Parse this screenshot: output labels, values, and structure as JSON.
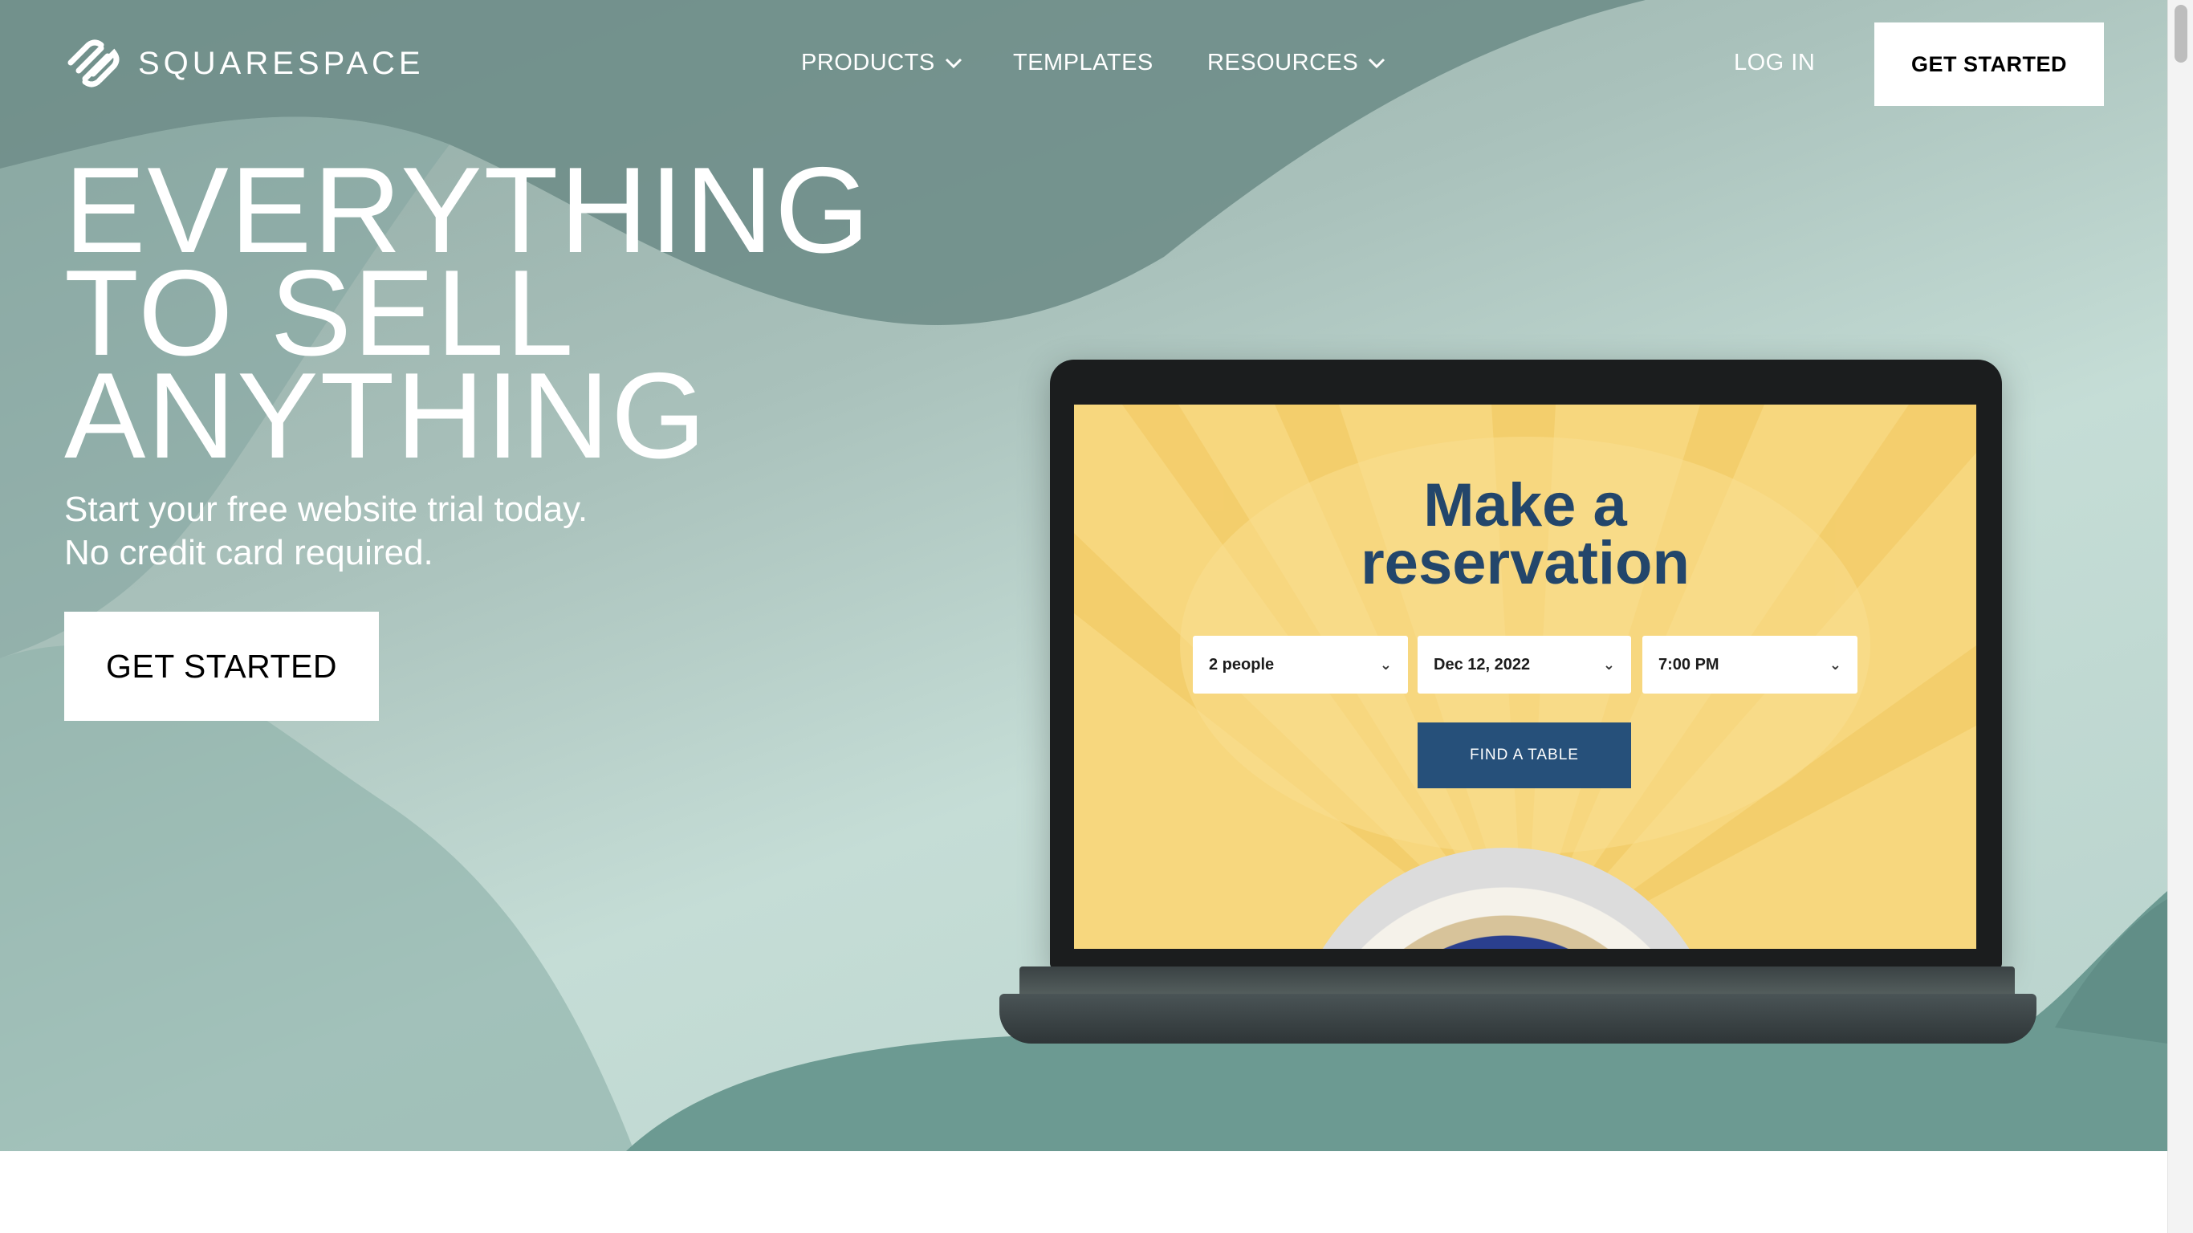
{
  "brand": {
    "name": "SQUARESPACE"
  },
  "nav": {
    "products": "PRODUCTS",
    "templates": "TEMPLATES",
    "resources": "RESOURCES",
    "login": "LOG IN",
    "get_started": "GET STARTED"
  },
  "hero": {
    "headline": [
      "EVERYTHING",
      "TO SELL",
      "ANYTHING"
    ],
    "subtext": [
      "Start your free website trial today.",
      "No credit card required."
    ],
    "cta": "GET STARTED"
  },
  "laptop_screen": {
    "title": [
      "Make a",
      "reservation"
    ],
    "fields": {
      "party": "2 people",
      "date": "Dec 12, 2022",
      "time": "7:00 PM"
    },
    "button": "FIND A TABLE"
  },
  "icons": {
    "logo": "squarespace-logo-icon",
    "dropdown": "chevron-down-icon"
  },
  "colors": {
    "hero_bg": "#a9c1bb",
    "screen_bg": "#f7d77e",
    "reservation_title": "#23466b",
    "find_button": "#26507a"
  }
}
